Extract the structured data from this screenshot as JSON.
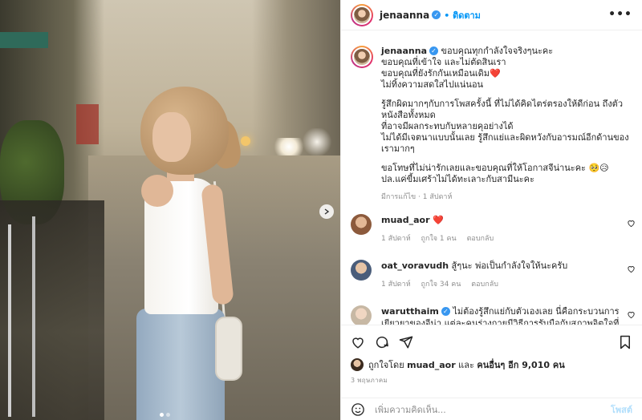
{
  "post": {
    "author": "jenaanna",
    "follow_label": "ติดตาม",
    "more_label": "•••",
    "caption_lines": [
      "ขอบคุณทุกกำลังใจจริงๆนะคะ",
      "ขอบคุณที่เข้าใจ และไม่ตัดสินเรา",
      "ขอบคุณที่ยังรักกันเหมือนเดิม❤️",
      "ไม่ทิ้งความสดใสไปแน่นอน",
      "รู้สึกผิดมากๆกับการโพสครั้งนี้ ที่ไม่ได้คิดไตร่ตรองให้ดีก่อน ถึงตัวหนังสือทั้งหมด",
      "ที่อาจมีผลกระทบกับหลายคุอย่างได้",
      "ไม่ได้มีเจตนาแบบนั้นเลย รู้สึกแย่และผิดหวังกับอารมณ์อีกด้านของเรามากๆ",
      "ขอโทษที่ไม่น่ารักเลยและขอบคุณที่ให้โอกาสจีน่านะคะ 🥺😥",
      "ปล.แค่ขี้มเศร้าไม่ได้ทะเลาะกับสามีนะคะ"
    ],
    "caption_meta": "มีการแก้ไข · 1 สัปดาห์",
    "photo_dots_total": 2,
    "photo_dots_active": 1
  },
  "comments": [
    {
      "user": "muad_aor",
      "text": "",
      "emoji": "❤️",
      "time": "1 สัปดาห์",
      "likes": "ถูกใจ 1 คน",
      "reply": "ตอบกลับ",
      "avatar_color": "#8c5a3c",
      "verified": false
    },
    {
      "user": "oat_voravudh",
      "text": "สู้ๆนะ พ่อเป็นกำลังใจให้นะครับ",
      "emoji": "",
      "time": "1 สัปดาห์",
      "likes": "ถูกใจ 34 คน",
      "reply": "ตอบกลับ",
      "avatar_color": "#4a5d7a",
      "verified": false
    },
    {
      "user": "warutthaim",
      "text": "ไม่ต้องรู้สึกแย่กับตัวเองเลย นี่คือกระบวนการเยียวยาของจีน่า แต่ละคนร่างกายมีวิธีการรับมือกับสภาพจิตใจที่แตกต่างกัน",
      "emoji": "",
      "time": "",
      "likes": "",
      "reply": "",
      "avatar_color": "#c7b8a4",
      "verified": true
    }
  ],
  "likes_summary": {
    "prefix": "ถูกใจโดย",
    "user": "muad_aor",
    "middle": "และ",
    "others": "คนอื่นๆ อีก 9,010 คน"
  },
  "date_label": "3 พฤษภาคม",
  "composer": {
    "placeholder": "เพิ่มความคิดเห็น...",
    "post_label": "โพสต์"
  },
  "icons": {
    "like": "heart-icon",
    "comment": "comment-icon",
    "share": "share-icon",
    "save": "bookmark-icon",
    "emoji": "emoji-icon",
    "next": "chevron-right-icon"
  },
  "colors": {
    "accent": "#0095f6",
    "verified": "#3897f0",
    "post_disabled": "#b2dffc"
  }
}
